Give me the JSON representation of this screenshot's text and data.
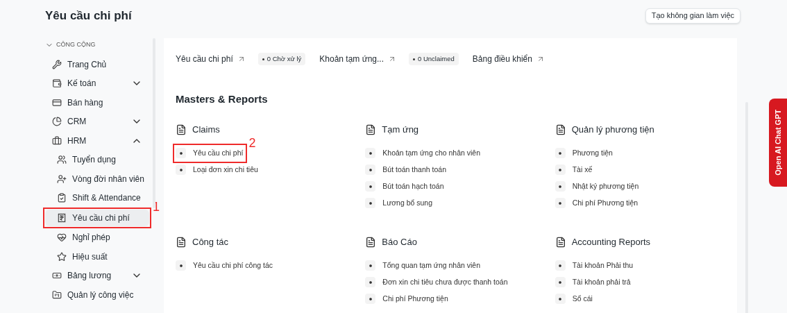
{
  "page": {
    "title": "Yêu cầu chi phí",
    "action": "Tạo không gian làm việc"
  },
  "sidebar": {
    "section": "CÔNG CỘNG",
    "expanded": true,
    "items": [
      {
        "label": "Trang Chủ"
      },
      {
        "label": "Kế toán",
        "expanded": false
      },
      {
        "label": "Bán hàng"
      },
      {
        "label": "CRM",
        "expanded": false
      },
      {
        "label": "HRM",
        "expanded": true,
        "children": [
          {
            "label": "Tuyển dụng",
            "selected": false
          },
          {
            "label": "Vòng đời nhân viên",
            "selected": false
          },
          {
            "label": "Shift & Attendance",
            "selected": false
          },
          {
            "label": "Yêu cầu chi phí",
            "selected": true,
            "callout": "1"
          },
          {
            "label": "Nghỉ phép",
            "selected": false
          },
          {
            "label": "Hiệu suất",
            "selected": false
          }
        ]
      },
      {
        "label": "Bảng lương",
        "expanded": false
      },
      {
        "label": "Quản lý công việc"
      }
    ]
  },
  "shortcuts": [
    {
      "label": "Yêu cầu chi phí",
      "badge": "0 Chờ xử lý"
    },
    {
      "label": "Khoản tạm ứng...",
      "badge": "0 Unclaimed"
    },
    {
      "label": "Bảng điều khiển"
    }
  ],
  "section_title": "Masters & Reports",
  "cards": [
    {
      "title": "Claims",
      "items": [
        {
          "label": "Yêu cầu chi phí",
          "callout": "2"
        },
        {
          "label": "Loại đơn xin chi tiêu"
        }
      ]
    },
    {
      "title": "Tạm ứng",
      "items": [
        {
          "label": "Khoản tạm ứng cho nhân viên"
        },
        {
          "label": "Bút toán thanh toán"
        },
        {
          "label": "Bút toán hạch toán"
        },
        {
          "label": "Lương bổ sung"
        }
      ]
    },
    {
      "title": "Quản lý phương tiện",
      "items": [
        {
          "label": "Phương tiện"
        },
        {
          "label": "Tài xế"
        },
        {
          "label": "Nhật ký phương tiện"
        },
        {
          "label": "Chi phí Phương tiện"
        }
      ]
    },
    {
      "title": "Công tác",
      "items": [
        {
          "label": "Yêu cầu chi phí công tác"
        }
      ]
    },
    {
      "title": "Báo Cáo",
      "items": [
        {
          "label": "Tổng quan tạm ứng nhân viên"
        },
        {
          "label": "Đơn xin chi tiêu chưa được thanh toán"
        },
        {
          "label": "Chi phí Phương tiện"
        }
      ]
    },
    {
      "title": "Accounting Reports",
      "items": [
        {
          "label": "Tài khoản Phải thu"
        },
        {
          "label": "Tài khoản phải trả"
        },
        {
          "label": "Sổ cái"
        }
      ]
    }
  ],
  "side_tab": "Open AI Chat GPT"
}
